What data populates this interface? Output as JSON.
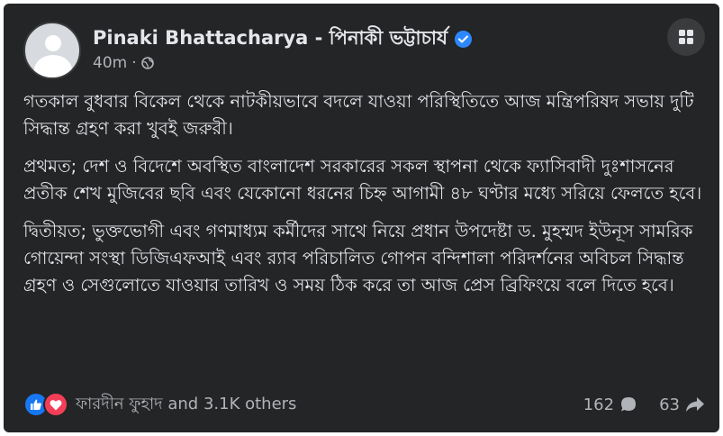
{
  "post": {
    "author": "Pinaki Bhattacharya - পিনাকী ভট্টাচার্য",
    "time": "40m",
    "separator": "·",
    "paragraphs": [
      "গতকাল বুধবার বিকেল থেকে নাটকীয়ভাবে বদলে যাওয়া পরিস্থিতিতে আজ মন্ত্রিপরিষদ সভায় দুটি সিদ্ধান্ত গ্রহণ করা খুবই জরুরী।",
      "প্রথমত; দেশ ও বিদেশে অবস্থিত বাংলাদেশ সরকারের সকল স্থাপনা থেকে ফ্যাসিবাদী দুঃশাসনের প্রতীক শেখ মুজিবের ছবি এবং যেকোনো ধরনের চিহ্ন আগামী ৪৮ ঘণ্টার মধ্যে সরিয়ে ফেলতে হবে।",
      "দ্বিতীয়ত; ভুক্তভোগী এবং গণমাধ্যম কর্মীদের সাথে নিয়ে প্রধান উপদেষ্টা ড. মুহম্মদ ইউনূস সামরিক গোয়েন্দা সংস্থা ডিজিএফআই এবং র‍্যাব পরিচালিত গোপন বন্দিশালা পরিদর্শনের অবিচল সিদ্ধান্ত গ্রহণ ও সেগুলোতে যাওয়ার তারিখ ও সময় ঠিক করে তা আজ প্রেস ব্রিফিংয়ে বলে দিতে হবে।"
    ]
  },
  "footer": {
    "reactors": "ফারদীন ফুহাদ and 3.1K others",
    "comments": "162",
    "shares": "63"
  },
  "icons": {
    "privacy": "globe-icon",
    "verified": "verified-badge-icon",
    "options": "grid-icon",
    "like": "like-reaction-icon",
    "love": "love-reaction-icon",
    "comment": "comment-icon",
    "share": "share-icon"
  },
  "colors": {
    "background": "#242526",
    "text": "#e4e6eb",
    "secondary": "#b0b3b8",
    "like": "#1877f2",
    "love": "#f33e58",
    "verified": "#2d88ff"
  }
}
